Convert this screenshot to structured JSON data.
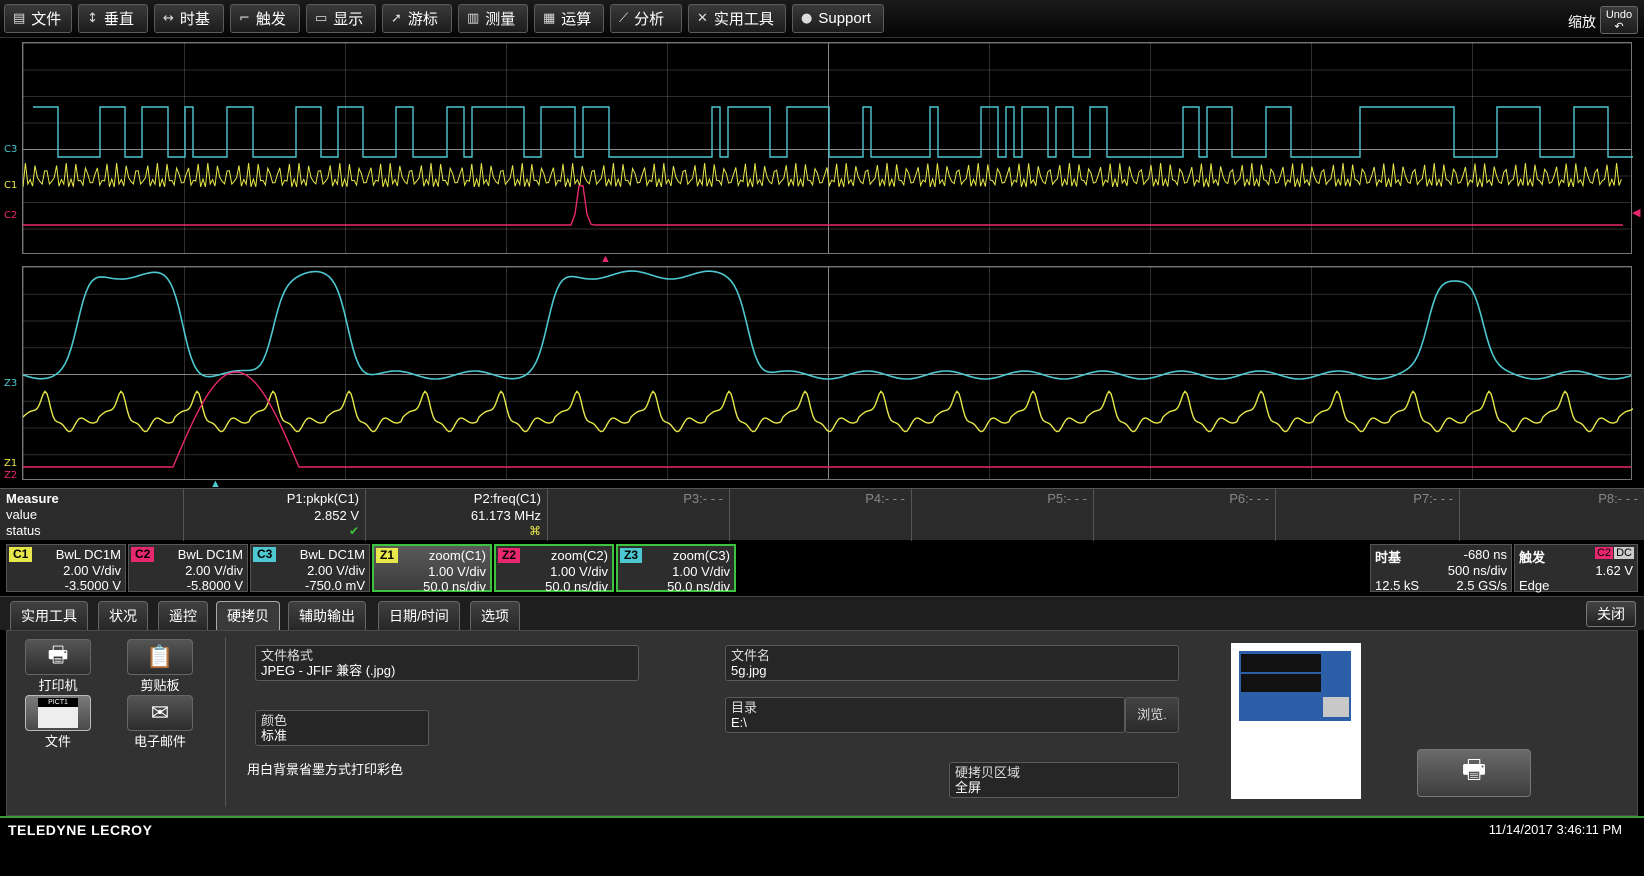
{
  "menu": [
    {
      "icon": "file-icon",
      "glyph": "▤",
      "label": "文件"
    },
    {
      "icon": "vertical-icon",
      "glyph": "↕",
      "label": "垂直"
    },
    {
      "icon": "timebase-icon",
      "glyph": "↔",
      "label": "时基"
    },
    {
      "icon": "trigger-icon",
      "glyph": "⌐",
      "label": "触发"
    },
    {
      "icon": "display-icon",
      "glyph": "▭",
      "label": "显示"
    },
    {
      "icon": "cursor-icon",
      "glyph": "➚",
      "label": "游标"
    },
    {
      "icon": "measure-icon",
      "glyph": "▥",
      "label": "测量"
    },
    {
      "icon": "math-icon",
      "glyph": "▦",
      "label": "运算"
    },
    {
      "icon": "analysis-icon",
      "glyph": "⟋",
      "label": "分析"
    },
    {
      "icon": "tools-icon",
      "glyph": "✕",
      "label": "实用工具"
    },
    {
      "icon": "support-icon",
      "glyph": "●",
      "label": "Support"
    }
  ],
  "zoom_label": "缩放",
  "undo_label": "Undo",
  "trace_labels": {
    "c3": "C3",
    "c1": "C1",
    "c2": "C2",
    "z3": "Z3",
    "z1": "Z1",
    "z2": "Z2"
  },
  "colors": {
    "c1": "#e8e84a",
    "c2": "#e8286e",
    "c3": "#4ec8d0",
    "zoom_border": "#3cc43c"
  },
  "measure": {
    "head": "Measure",
    "value_label": "value",
    "status_label": "status",
    "params": [
      {
        "title": "P1:pkpk(C1)",
        "value": "2.852 V",
        "status": "✔"
      },
      {
        "title": "P2:freq(C1)",
        "value": "61.173 MHz",
        "status": "⌘"
      },
      {
        "title": "P3:- - -",
        "value": "",
        "status": ""
      },
      {
        "title": "P4:- - -",
        "value": "",
        "status": ""
      },
      {
        "title": "P5:- - -",
        "value": "",
        "status": ""
      },
      {
        "title": "P6:- - -",
        "value": "",
        "status": ""
      },
      {
        "title": "P7:- - -",
        "value": "",
        "status": ""
      },
      {
        "title": "P8:- - -",
        "value": "",
        "status": ""
      }
    ]
  },
  "channels": [
    {
      "tag": "C1",
      "a": "BwL  DC1M",
      "b": "2.00 V/div",
      "c": "-3.5000 V"
    },
    {
      "tag": "C2",
      "a": "BwL  DC1M",
      "b": "2.00 V/div",
      "c": "-5.8000 V"
    },
    {
      "tag": "C3",
      "a": "BwL  DC1M",
      "b": "2.00 V/div",
      "c": "-750.0 mV"
    },
    {
      "tag": "Z1",
      "a": "zoom(C1)",
      "b": "1.00 V/div",
      "c": "50.0 ns/div"
    },
    {
      "tag": "Z2",
      "a": "zoom(C2)",
      "b": "1.00 V/div",
      "c": "50.0 ns/div"
    },
    {
      "tag": "Z3",
      "a": "zoom(C3)",
      "b": "1.00 V/div",
      "c": "50.0 ns/div"
    }
  ],
  "timebase": {
    "title": "时基",
    "delay": "-680 ns",
    "per_div": "500 ns/div",
    "samples": "12.5 kS",
    "rate": "2.5 GS/s"
  },
  "trigger": {
    "title": "触发",
    "source": "C2",
    "coupling": "DC",
    "level": "1.62 V",
    "type": "Edge"
  },
  "tabs": [
    "实用工具",
    "状况",
    "遥控",
    "硬拷贝",
    "辅助输出",
    "日期/时间",
    "选项"
  ],
  "close_label": "关闭",
  "hardcopy": {
    "printer": "打印机",
    "clipboard": "剪贴板",
    "file": "文件",
    "email": "电子邮件",
    "file_icon_text": "PICT1",
    "format_label": "文件格式",
    "format_value": "JPEG - JFIF 兼容 (.jpg)",
    "color_label": "颜色",
    "color_value": "标准",
    "note": "用白背景省墨方式打印彩色",
    "filename_label": "文件名",
    "filename_value": "5g.jpg",
    "dir_label": "目录",
    "dir_value": "E:\\",
    "browse": "浏览.",
    "area_label": "硬拷贝区域",
    "area_value": "全屏"
  },
  "footer": {
    "brand": "TELEDYNE LECROY",
    "datetime": "11/14/2017 3:46:11 PM"
  }
}
